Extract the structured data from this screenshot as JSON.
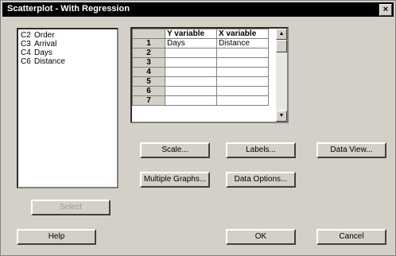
{
  "window": {
    "title": "Scatterplot - With Regression",
    "close_glyph": "×"
  },
  "variables": [
    {
      "col": "C2",
      "name": "Order"
    },
    {
      "col": "C3",
      "name": "Arrival"
    },
    {
      "col": "C4",
      "name": "Days"
    },
    {
      "col": "C6",
      "name": "Distance"
    }
  ],
  "grid": {
    "headers": [
      "Y variable",
      "X variable"
    ],
    "rows": [
      {
        "n": "1",
        "y": "Days",
        "x": "Distance"
      },
      {
        "n": "2",
        "y": "",
        "x": ""
      },
      {
        "n": "3",
        "y": "",
        "x": ""
      },
      {
        "n": "4",
        "y": "",
        "x": ""
      },
      {
        "n": "5",
        "y": "",
        "x": ""
      },
      {
        "n": "6",
        "y": "",
        "x": ""
      },
      {
        "n": "7",
        "y": "",
        "x": ""
      }
    ]
  },
  "buttons": {
    "scale": "Scale...",
    "labels": "Labels...",
    "data_view": "Data View...",
    "multiple_graphs": "Multiple Graphs...",
    "data_options": "Data Options...",
    "select": "Select",
    "help": "Help",
    "ok": "OK",
    "cancel": "Cancel"
  },
  "colors": {
    "dialog_bg": "#d4d0c8",
    "titlebar_bg": "#000000",
    "title_text": "#ffffff"
  }
}
